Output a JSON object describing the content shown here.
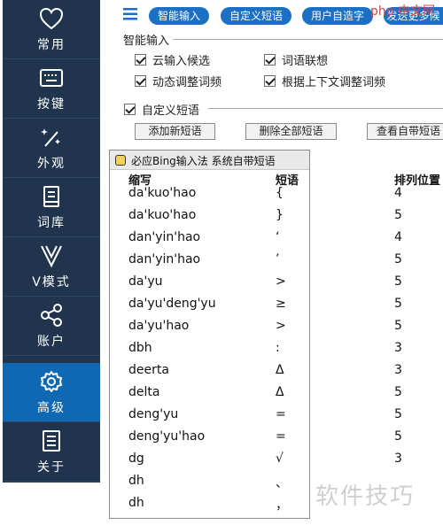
{
  "sidebar": {
    "items": [
      {
        "label": "常用",
        "icon": "heart-icon"
      },
      {
        "label": "按键",
        "icon": "keyboard-icon"
      },
      {
        "label": "外观",
        "icon": "magic-wand-icon"
      },
      {
        "label": "词库",
        "icon": "book-icon"
      },
      {
        "label": "V模式",
        "icon": "v-letter-icon"
      },
      {
        "label": "账户",
        "icon": "share-nodes-icon"
      },
      {
        "label": "高级",
        "icon": "gear-icon"
      },
      {
        "label": "关于",
        "icon": "document-icon"
      }
    ],
    "active_index": 6
  },
  "topbar": {
    "tabs": [
      "智能输入",
      "自定义短语",
      "用户自造字",
      "发送更多候"
    ]
  },
  "smart_input": {
    "title": "智能输入",
    "options": [
      {
        "label": "云输入候选",
        "checked": true
      },
      {
        "label": "词语联想",
        "checked": true
      },
      {
        "label": "动态调整词频",
        "checked": true
      },
      {
        "label": "根据上下文调整词频",
        "checked": true
      }
    ]
  },
  "custom_phrase": {
    "title": "自定义短语",
    "checked": true,
    "buttons": [
      "添加新短语",
      "删除全部短语",
      "查看自带短语"
    ]
  },
  "popup": {
    "title": "必应Bing输入法 系统自带短语",
    "columns": [
      "缩写",
      "短语",
      "排列位置"
    ],
    "rows": [
      [
        "da'kuo'hao",
        "{",
        "4"
      ],
      [
        "da'kuo'hao",
        "}",
        "5"
      ],
      [
        "dan'yin'hao",
        "‘",
        "4"
      ],
      [
        "dan'yin'hao",
        "’",
        "5"
      ],
      [
        "da'yu",
        ">",
        "5"
      ],
      [
        "da'yu'deng'yu",
        "≥",
        "5"
      ],
      [
        "da'yu'hao",
        ">",
        "5"
      ],
      [
        "dbh",
        ":",
        "3"
      ],
      [
        "deerta",
        "Δ",
        "3"
      ],
      [
        "delta",
        "Δ",
        "5"
      ],
      [
        "deng'yu",
        "=",
        "5"
      ],
      [
        "deng'yu'hao",
        "=",
        "5"
      ],
      [
        "dg",
        "√",
        "3"
      ],
      [
        "dh",
        "、",
        ""
      ],
      [
        "dh",
        "，",
        ""
      ]
    ]
  },
  "watermarks": {
    "top": "php 中文网",
    "bottom": "软件技巧"
  },
  "colors": {
    "sidebar_bg": "#20344e",
    "sidebar_active": "#0f68b4",
    "tab_bg": "#1b6fc4"
  }
}
